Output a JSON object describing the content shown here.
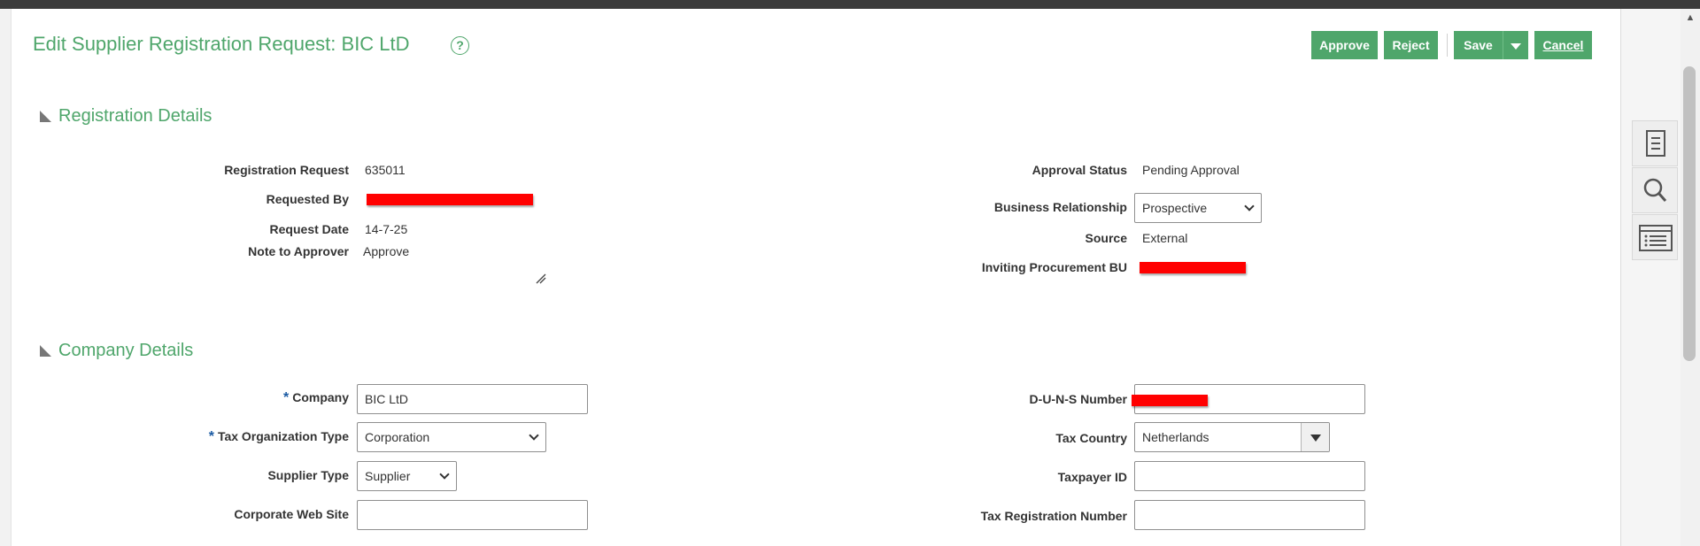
{
  "page": {
    "title": "Edit Supplier Registration Request: BIC LtD",
    "help_icon": "question-circle-icon"
  },
  "toolbar": {
    "approve_label": "Approve",
    "reject_label": "Reject",
    "save_label": "Save",
    "cancel_label": "Cancel"
  },
  "colors": {
    "accent": "#4fa66b",
    "redaction": "#ff0000",
    "required_star": "#1a5aa3"
  },
  "registration_details": {
    "heading": "Registration Details",
    "registration_request": {
      "label": "Registration Request",
      "value": "635011"
    },
    "requested_by": {
      "label": "Requested By"
    },
    "request_date": {
      "label": "Request Date",
      "value": "14-7-25"
    },
    "note_to_approver": {
      "label": "Note to Approver",
      "value": "Approve"
    },
    "approval_status": {
      "label": "Approval Status",
      "value": "Pending Approval"
    },
    "business_relationship": {
      "label": "Business Relationship",
      "value": "Prospective"
    },
    "source": {
      "label": "Source",
      "value": "External"
    },
    "inviting_procurement_bu": {
      "label": "Inviting Procurement BU"
    }
  },
  "company_details": {
    "heading": "Company Details",
    "required_marker": "*",
    "company": {
      "label": "Company",
      "value": "BIC LtD"
    },
    "tax_organization_type": {
      "label": "Tax Organization Type",
      "value": "Corporation"
    },
    "supplier_type": {
      "label": "Supplier Type",
      "value": "Supplier"
    },
    "corporate_web_site": {
      "label": "Corporate Web Site",
      "value": ""
    },
    "duns_number": {
      "label": "D-U-N-S Number"
    },
    "tax_country": {
      "label": "Tax Country",
      "value": "Netherlands"
    },
    "taxpayer_id": {
      "label": "Taxpayer ID",
      "value": ""
    },
    "tax_registration_number": {
      "label": "Tax Registration Number",
      "value": ""
    }
  },
  "side_panel": {
    "icons": [
      "document-icon",
      "search-icon",
      "list-icon"
    ]
  }
}
